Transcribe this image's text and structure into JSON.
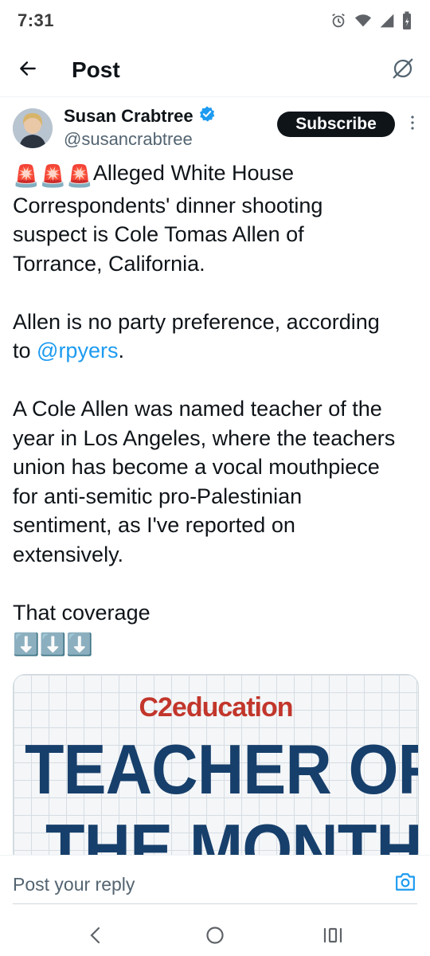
{
  "status_bar": {
    "time": "7:31",
    "icons": [
      "alarm-icon",
      "wifi-icon",
      "signal-icon",
      "battery-icon"
    ]
  },
  "header": {
    "title": "Post",
    "back_icon": "arrow-left-icon",
    "grok_icon": "grok-icon"
  },
  "post": {
    "author_name": "Susan Crabtree",
    "verified": true,
    "author_handle": "@susancrabtree",
    "subscribe_label": "Subscribe",
    "text_line1_after_emoji": "Alleged White House",
    "text_para1_rest": "Correspondents' dinner shooting\nsuspect is Cole Tomas Allen of\nTorrance, California.",
    "text_para2_before": "Allen is no party preference, according\nto ",
    "mention": "@rpyers",
    "text_para2_after": ".",
    "text_para3": "A Cole Allen was named teacher of the\nyear in Los Angeles, where the teachers\nunion has become a vocal mouthpiece\nfor anti-semitic pro-Palestinian\nsentiment, as I've reported on\nextensively.",
    "text_para4": "That coverage",
    "siren_emoji": "🚨",
    "down_arrow_emoji": "⬇️"
  },
  "media": {
    "brand": "C2education",
    "headline_line1": "TEACHER OF",
    "headline_line2": "THE MONTH"
  },
  "reply": {
    "placeholder": "Post your reply",
    "camera_icon": "camera-icon"
  },
  "nav": {
    "back_icon": "nav-back-icon",
    "home_icon": "nav-home-icon",
    "recents_icon": "nav-recents-icon"
  },
  "colors": {
    "accent": "#1d9bf0",
    "text": "#0f1419",
    "secondary": "#536471",
    "verified": "#1d9bf0",
    "media_brand": "#c2362b",
    "media_headline": "#173f6b"
  }
}
